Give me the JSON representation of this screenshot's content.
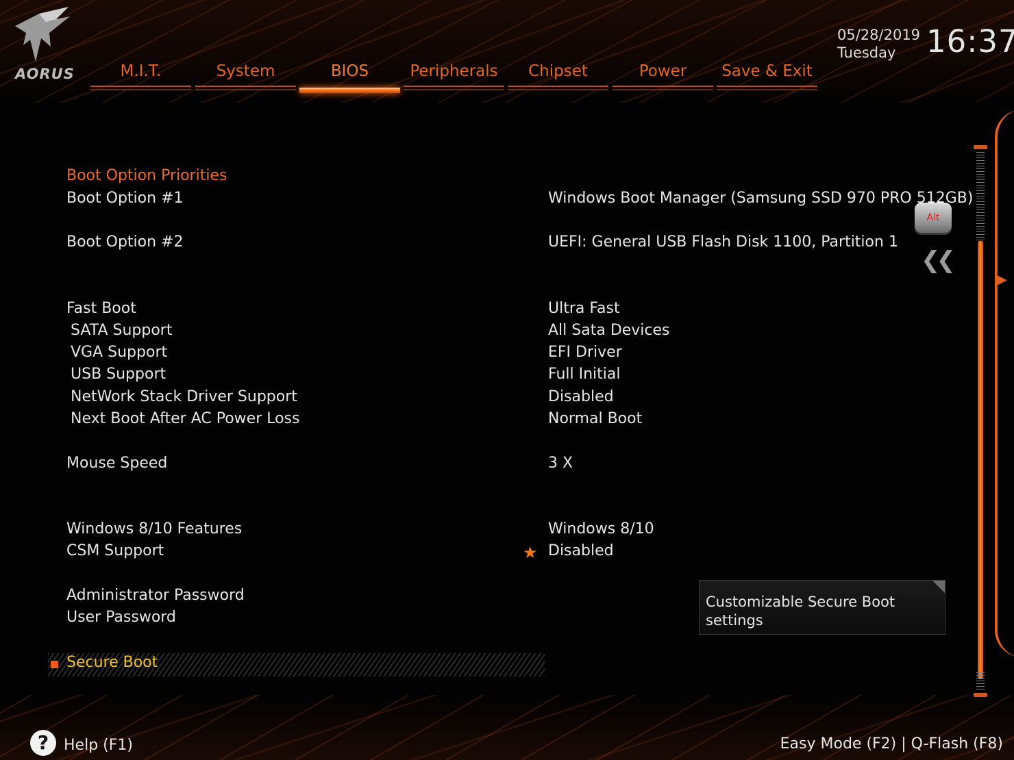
{
  "brand": {
    "logo_text": "AORUS"
  },
  "tabs": [
    {
      "label": "M.I.T.",
      "active": false
    },
    {
      "label": "System",
      "active": false
    },
    {
      "label": "BIOS",
      "active": true
    },
    {
      "label": "Peripherals",
      "active": false
    },
    {
      "label": "Chipset",
      "active": false
    },
    {
      "label": "Power",
      "active": false
    },
    {
      "label": "Save & Exit",
      "active": false
    }
  ],
  "datetime": {
    "date": "05/28/2019",
    "day": "Tuesday",
    "time": "16:37"
  },
  "section": {
    "title": "Boot Option Priorities"
  },
  "settings": [
    {
      "label": "Boot Option #1",
      "value": "Windows Boot Manager (Samsung SSD 970 PRO 512GB)"
    },
    {
      "label": "Boot Option #2",
      "value": "UEFI: General USB Flash Disk 1100, Partition 1"
    },
    {
      "label": "Fast Boot",
      "value": "Ultra Fast"
    },
    {
      "label": "SATA Support",
      "value": "All Sata Devices"
    },
    {
      "label": "VGA Support",
      "value": "EFI Driver"
    },
    {
      "label": "USB Support",
      "value": "Full Initial"
    },
    {
      "label": "NetWork Stack Driver Support",
      "value": "Disabled"
    },
    {
      "label": "Next Boot After AC Power Loss",
      "value": "Normal Boot"
    },
    {
      "label": "Mouse Speed",
      "value": "3 X"
    },
    {
      "label": "Windows 8/10 Features",
      "value": "Windows 8/10"
    },
    {
      "label": "CSM Support",
      "value": "Disabled"
    },
    {
      "label": "Administrator Password",
      "value": ""
    },
    {
      "label": "User Password",
      "value": ""
    }
  ],
  "selected_item": {
    "label": "Secure Boot"
  },
  "help_box": {
    "text": "Customizable Secure Boot settings"
  },
  "alt_key": {
    "label": "Alt"
  },
  "footer": {
    "help": "Help (F1)",
    "right": "Easy Mode (F2)  |  Q-Flash (F8)"
  },
  "colors": {
    "accent": "#ef6a22",
    "selected": "#f0c032",
    "text": "#e6e6e6"
  }
}
